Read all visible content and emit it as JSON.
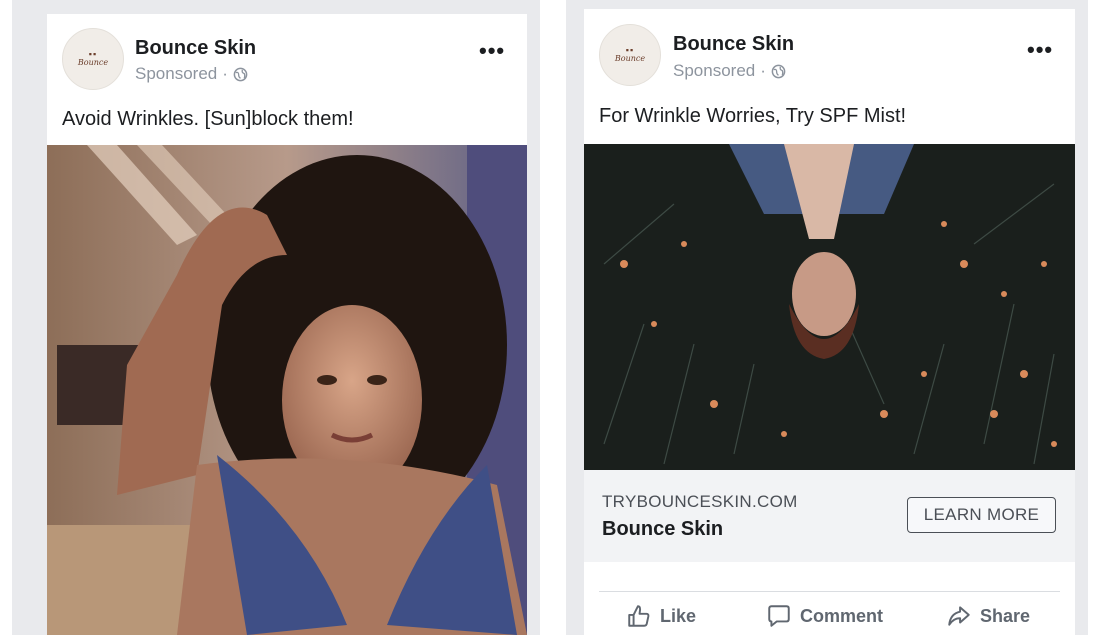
{
  "ads": [
    {
      "brand": "Bounce Skin",
      "avatar_text": "Bounce",
      "sponsored": "Sponsored",
      "caption": "Avoid Wrinkles. [Sun]block them!"
    },
    {
      "brand": "Bounce Skin",
      "avatar_text": "Bounce",
      "sponsored": "Sponsored",
      "caption": "For Wrinkle Worries, Try SPF Mist!",
      "link_domain": "TRYBOUNCESKIN.COM",
      "link_title": "Bounce Skin",
      "cta_label": "LEARN MORE",
      "actions": {
        "like": "Like",
        "comment": "Comment",
        "share": "Share"
      }
    }
  ],
  "icons": [
    "more-options-icon",
    "globe-icon",
    "like-icon",
    "comment-icon",
    "share-icon"
  ],
  "colors": {
    "secondary_text": "#8d949e",
    "feed_background": "#e9eaed",
    "action_text": "#606770"
  }
}
